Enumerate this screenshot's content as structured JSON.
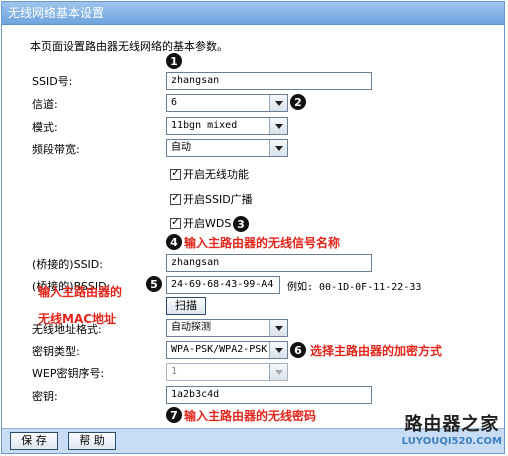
{
  "window": {
    "title": "无线网络基本设置"
  },
  "intro": "本页面设置路由器无线网络的基本参数。",
  "fields": {
    "ssid": {
      "label": "SSID号:",
      "value": "zhangsan"
    },
    "channel": {
      "label": "信道:",
      "value": "6"
    },
    "mode": {
      "label": "模式:",
      "value": "11bgn mixed"
    },
    "bandwidth": {
      "label": "频段带宽:",
      "value": "自动"
    },
    "enable_wireless": {
      "label": "开启无线功能",
      "checked": true
    },
    "enable_ssid_broadcast": {
      "label": "开启SSID广播",
      "checked": true
    },
    "enable_wds": {
      "label": "开启WDS",
      "checked": true
    },
    "bridge_ssid": {
      "label": "(桥接的)SSID:",
      "value": "zhangsan"
    },
    "bridge_bssid": {
      "label": "(桥接的)BSSID:",
      "value": "24-69-68-43-99-A4",
      "example": "例如: 00-1D-0F-11-22-33"
    },
    "scan_button": "扫描",
    "address_format": {
      "label": "无线地址格式:",
      "value": "自动探测"
    },
    "key_type": {
      "label": "密钥类型:",
      "value": "WPA-PSK/WPA2-PSK"
    },
    "wep_index": {
      "label": "WEP密钥序号:",
      "value": "1"
    },
    "key": {
      "label": "密钥:",
      "value": "1a2b3c4d"
    }
  },
  "annotations": {
    "n1": "1",
    "n2": "2",
    "n3": "3",
    "n4": "4",
    "n5": "5",
    "n6": "6",
    "n7": "7",
    "a4": "输入主路由器的无线信号名称",
    "a5_line1": "输入主路由器的",
    "a5_line2": "无线MAC地址",
    "a6": "选择主路由器的加密方式",
    "a7": "输入主路由器的无线密码",
    "color": "#e3241b"
  },
  "footer": {
    "save": "保 存",
    "help": "帮 助"
  },
  "watermark": {
    "line1": "路由器之家",
    "line2": "LUYOUQI520.COM"
  }
}
